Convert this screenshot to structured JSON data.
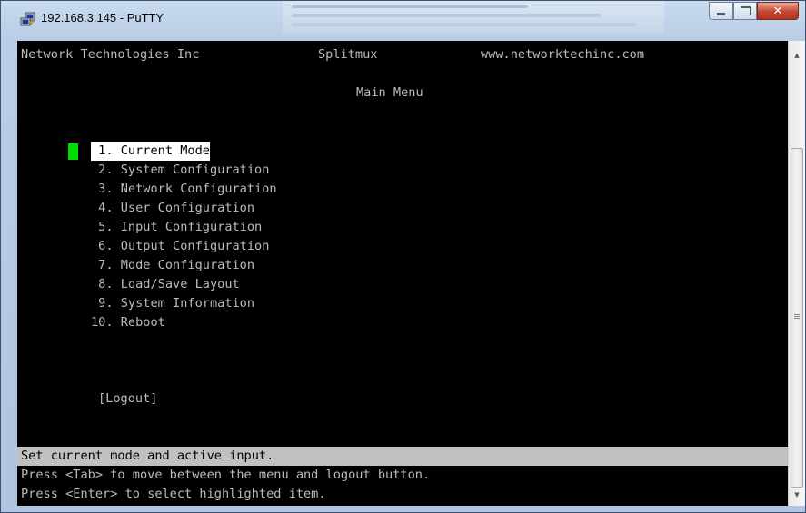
{
  "window": {
    "title": "192.168.3.145 - PuTTY",
    "app_icon": "putty-icon",
    "controls": {
      "minimize": "minimize-icon",
      "maximize": "maximize-icon",
      "close": "✕"
    }
  },
  "terminal": {
    "header": {
      "company": "Network Technologies Inc",
      "product": "Splitmux",
      "website": "www.networktechinc.com"
    },
    "menu_title": "Main Menu",
    "menu_items": [
      {
        "label": " 1. Current Mode"
      },
      {
        "label": " 2. System Configuration"
      },
      {
        "label": " 3. Network Configuration"
      },
      {
        "label": " 4. User Configuration"
      },
      {
        "label": " 5. Input Configuration"
      },
      {
        "label": " 6. Output Configuration"
      },
      {
        "label": " 7. Mode Configuration"
      },
      {
        "label": " 8. Load/Save Layout"
      },
      {
        "label": " 9. System Information"
      },
      {
        "label": "10. Reboot"
      }
    ],
    "logout_label": "[Logout]",
    "status_text": "Set current mode and active input.",
    "help_lines": [
      "Press <Tab> to move between the menu and logout button.",
      "Press <Enter> to select highlighted item."
    ]
  },
  "colors": {
    "terminal_bg": "#000000",
    "terminal_fg": "#bbbbbb",
    "highlight_bg": "#ffffff",
    "cursor": "#00dd00",
    "status_bg": "#c0c0c0"
  }
}
